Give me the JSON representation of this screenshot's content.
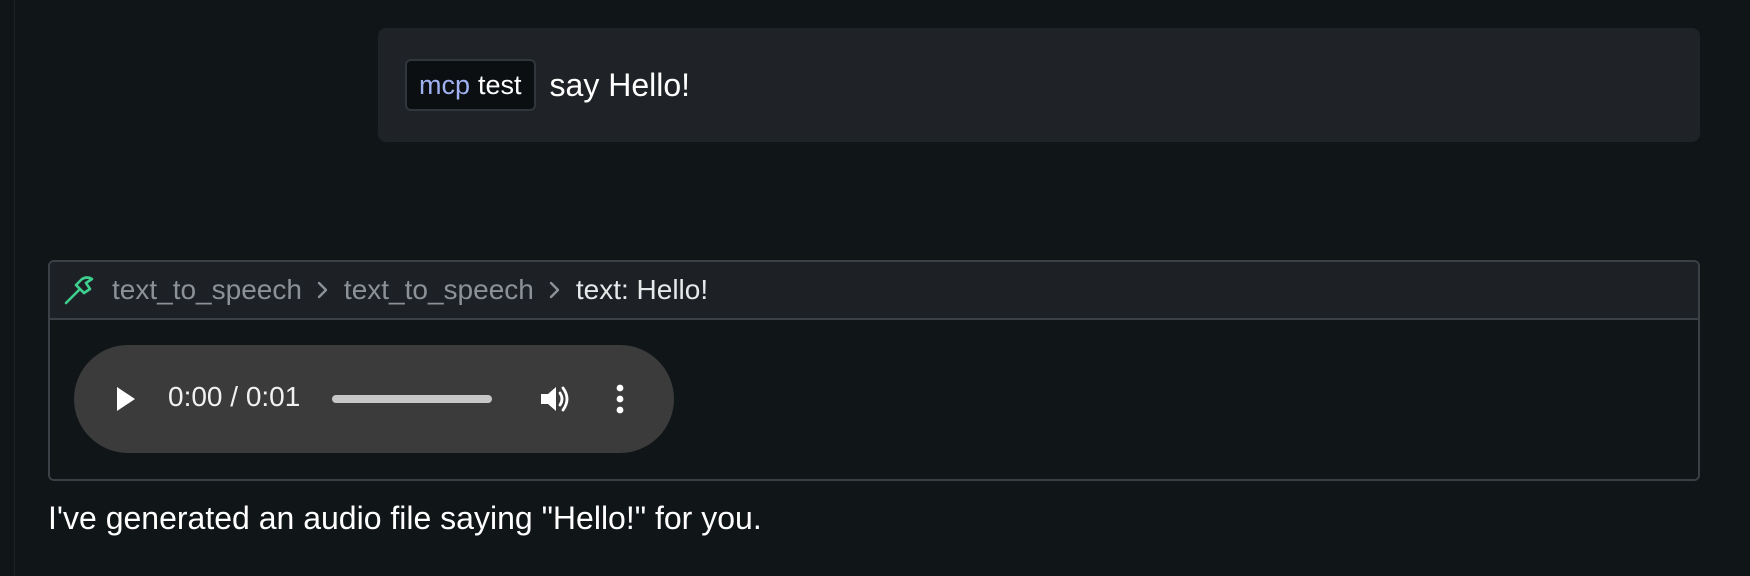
{
  "user_message": {
    "chip": {
      "kind": "mcp",
      "name": "test"
    },
    "text": "say Hello!"
  },
  "tool_call": {
    "icon": "hammer-icon",
    "breadcrumb": [
      "text_to_speech",
      "text_to_speech",
      "text: Hello!"
    ],
    "audio": {
      "time": "0:00 / 0:01",
      "progress_fraction": 0.0,
      "controls": [
        "play-icon",
        "volume-icon",
        "more-options-icon"
      ]
    }
  },
  "assistant_reply": {
    "text": "I've generated an audio file saying \"Hello!\" for you."
  },
  "colors": {
    "background": "#101518",
    "tool_accent": "#3ecf8e",
    "chip_kind": "#9fb1f0",
    "player_bg": "#3a3b3a"
  }
}
